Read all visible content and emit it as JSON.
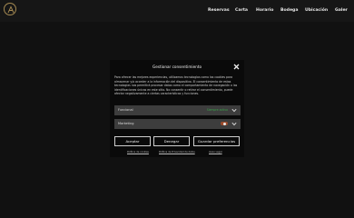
{
  "nav": {
    "links": [
      "Reservas",
      "Carta",
      "Horario",
      "Bodega",
      "Ubicación",
      "Galer"
    ]
  },
  "modal": {
    "title": "Gestionar consentimiento",
    "body": "Para ofrecer las mejores experiencias, utilizamos tecnologías como las cookies para almacenar y/o acceder a la información del dispositivo. El consentimiento de estas tecnologías nos permitirá procesar datos como el comportamiento de navegación o las identificaciones únicas en este sitio. No consentir o retirar el consentimiento, puede afectar negativamente a ciertas características y funciones.",
    "accordions": [
      {
        "label": "Funcional",
        "status": "Siempre activo"
      },
      {
        "label": "Marketing",
        "status": ""
      }
    ],
    "buttons": {
      "accept": "Aceptar",
      "deny": "Denegar",
      "preferences": "Guardar preferencias"
    },
    "footer": [
      "Política de cookies",
      "Política de Privacidad de datos",
      "Aviso Legal"
    ]
  },
  "colors": {
    "page_bg": "#1c1c1c",
    "modal_bg": "#0a0a0a",
    "accordion_bg": "#3d3d3d",
    "status_green": "#3aa44a",
    "toggle_off": "#9a4a2a",
    "logo_gold": "#a58a52"
  }
}
